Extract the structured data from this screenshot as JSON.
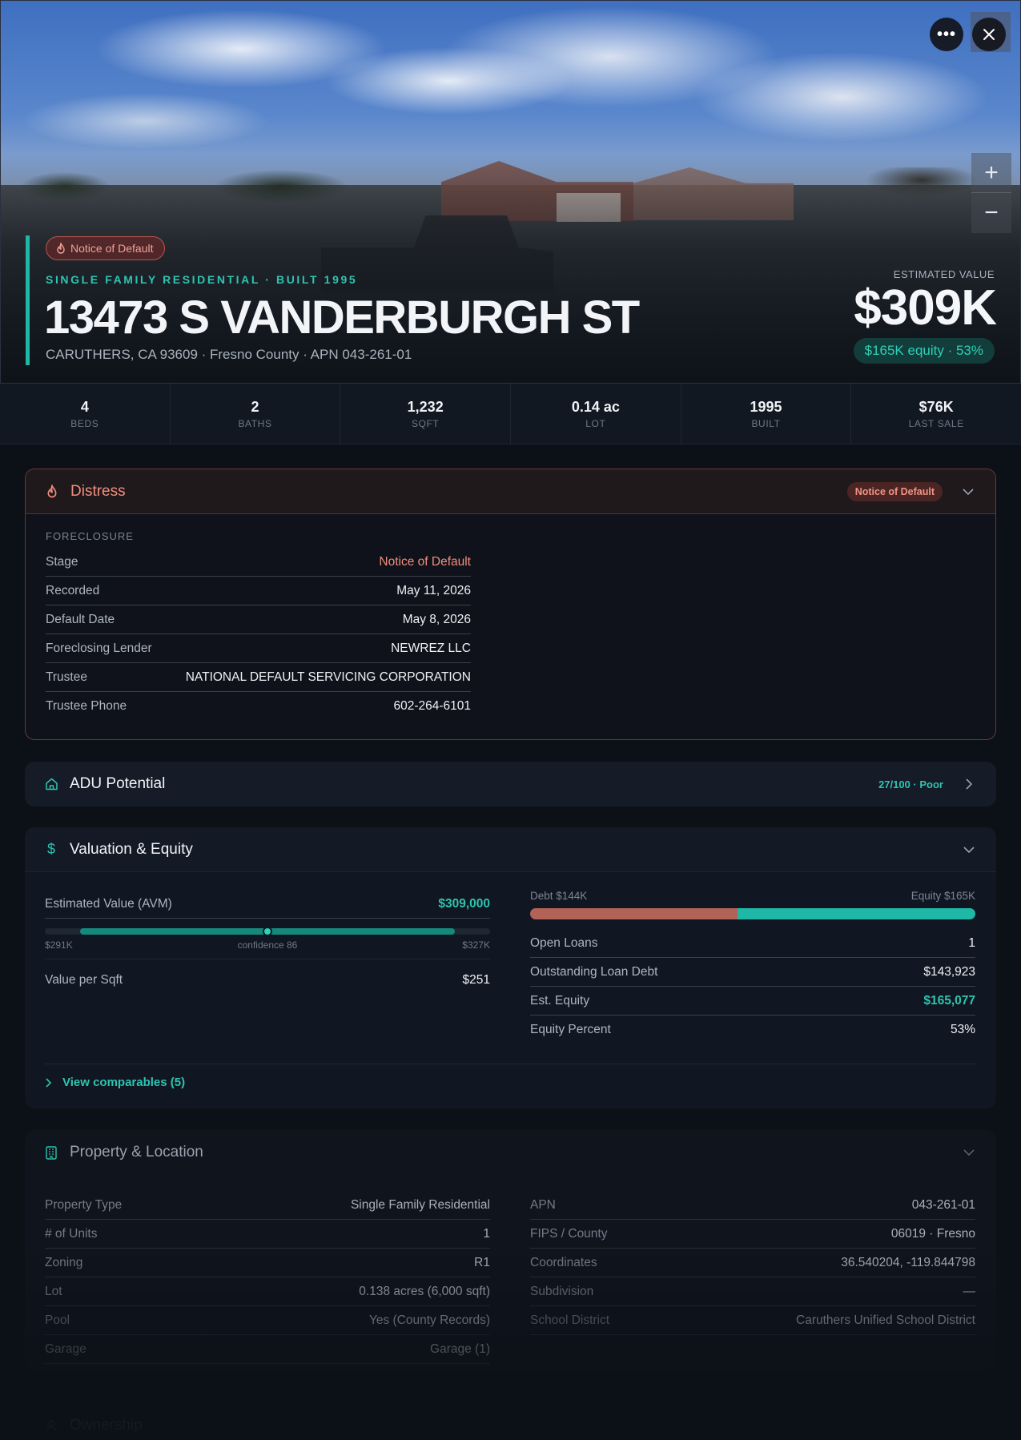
{
  "hero": {
    "badge": "Notice of Default",
    "kicker": "SINGLE FAMILY RESIDENTIAL · BUILT 1995",
    "title": "13473 S VANDERBURGH ST",
    "subtitle": "CARUTHERS, CA 93609 · Fresno County · APN 043-261-01",
    "estimated_label": "ESTIMATED VALUE",
    "estimated_value": "$309K",
    "equity_pill": "$165K equity · 53%",
    "zoom_in": "+",
    "zoom_out": "−"
  },
  "stats": [
    {
      "value": "4",
      "label": "BEDS"
    },
    {
      "value": "2",
      "label": "BATHS"
    },
    {
      "value": "1,232",
      "label": "SQFT"
    },
    {
      "value": "0.14 ac",
      "label": "LOT"
    },
    {
      "value": "1995",
      "label": "BUILT"
    },
    {
      "value": "$76K",
      "label": "LAST SALE"
    }
  ],
  "distress": {
    "title": "Distress",
    "badge": "Notice of Default",
    "section": "FORECLOSURE",
    "rows": [
      {
        "k": "Stage",
        "v": "Notice of Default"
      },
      {
        "k": "Recorded",
        "v": "May 11, 2026"
      },
      {
        "k": "Default Date",
        "v": "May 8, 2026"
      },
      {
        "k": "Foreclosing Lender",
        "v": "NEWREZ LLC"
      },
      {
        "k": "Trustee",
        "v": "NATIONAL DEFAULT SERVICING CORPORATION"
      },
      {
        "k": "Trustee Phone",
        "v": "602-264-6101"
      }
    ]
  },
  "adu": {
    "title": "ADU Potential",
    "score": "27/100 · Poor"
  },
  "valuation": {
    "title": "Valuation & Equity",
    "avm_label": "Estimated Value (AVM)",
    "avm_value": "$309,000",
    "range_low": "$291K",
    "confidence": "confidence 86",
    "range_high": "$327K",
    "range_marker_fraction": 0.5,
    "sqft_label": "Value per Sqft",
    "sqft_value": "$251",
    "debt_label": "Debt $144K",
    "equity_label": "Equity $165K",
    "debt_fraction": 0.466,
    "rows": [
      {
        "k": "Open Loans",
        "v": "1"
      },
      {
        "k": "Outstanding Loan Debt",
        "v": "$143,923"
      },
      {
        "k": "Est. Equity",
        "v": "$165,077"
      },
      {
        "k": "Equity Percent",
        "v": "53%"
      }
    ],
    "comparables": "View comparables (5)"
  },
  "property": {
    "title": "Property & Location",
    "left": [
      {
        "k": "Property Type",
        "v": "Single Family Residential"
      },
      {
        "k": "# of Units",
        "v": "1"
      },
      {
        "k": "Zoning",
        "v": "R1"
      },
      {
        "k": "Lot",
        "v": "0.138 acres (6,000 sqft)"
      },
      {
        "k": "Pool",
        "v": "Yes (County Records)"
      },
      {
        "k": "Garage",
        "v": "Garage (1)"
      }
    ],
    "right": [
      {
        "k": "APN",
        "v": "043-261-01"
      },
      {
        "k": "FIPS / County",
        "v": "06019 · Fresno"
      },
      {
        "k": "Coordinates",
        "v": "36.540204, -119.844798"
      },
      {
        "k": "Subdivision",
        "v": "—"
      },
      {
        "k": "School District",
        "v": "Caruthers Unified School District"
      }
    ]
  },
  "ownership": {
    "title": "Ownership"
  },
  "colors": {
    "accent": "#1fb8a6",
    "distress": "#f08e7d",
    "debt": "#b36356"
  }
}
